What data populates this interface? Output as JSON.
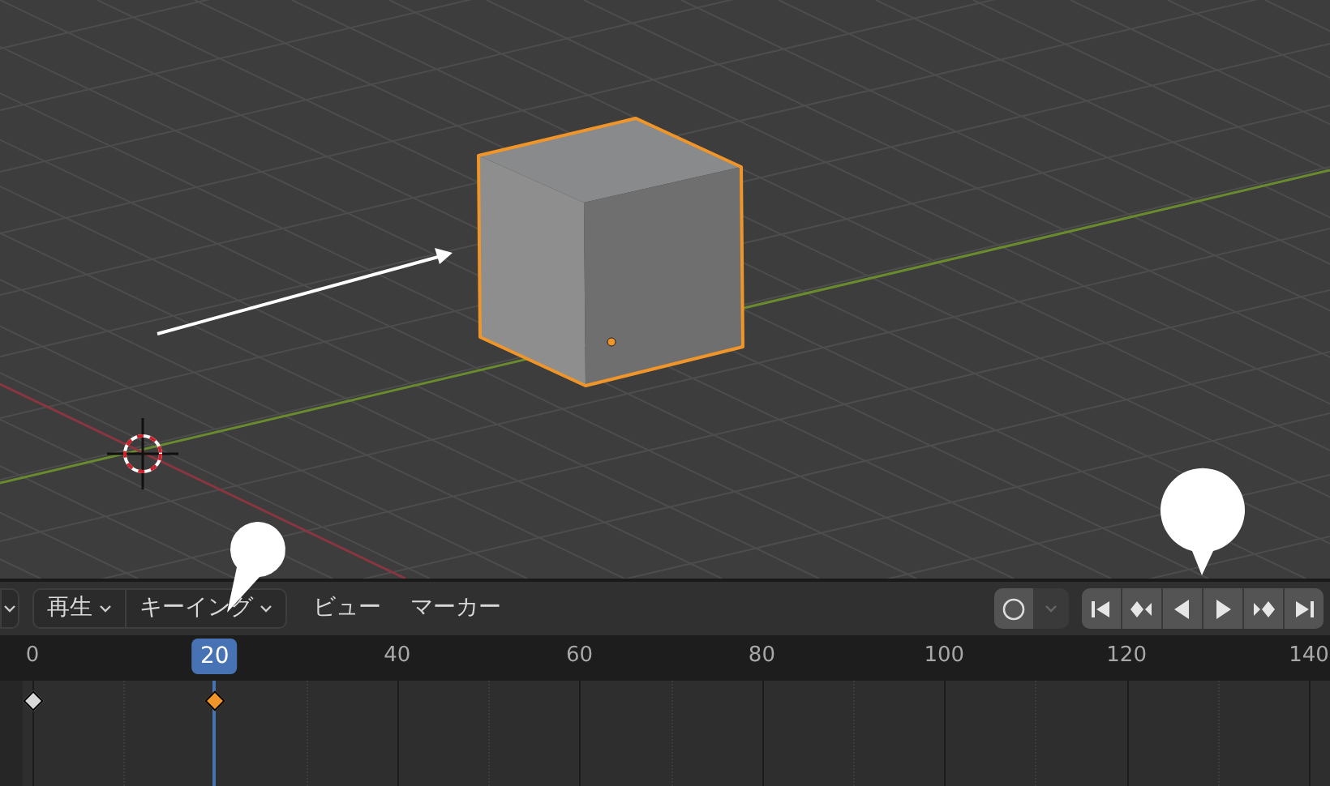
{
  "header": {
    "menus": [
      {
        "kind": "dropdown",
        "label": "再生"
      },
      {
        "kind": "dropdown",
        "label": "キーイング"
      },
      {
        "kind": "menu",
        "label": "ビュー"
      },
      {
        "kind": "menu",
        "label": "マーカー"
      }
    ],
    "auto_keying": {
      "on": false
    }
  },
  "timeline": {
    "ticks": [
      {
        "label": "0",
        "current": false
      },
      {
        "label": "20",
        "current": true
      },
      {
        "label": "40",
        "current": false
      },
      {
        "label": "60",
        "current": false
      },
      {
        "label": "80",
        "current": false
      },
      {
        "label": "100",
        "current": false
      },
      {
        "label": "120",
        "current": false
      },
      {
        "label": "140",
        "current": false
      }
    ],
    "keyframes": [
      {
        "level": 0,
        "selected": false
      },
      {
        "level": 0.1429,
        "selected": true
      }
    ]
  }
}
